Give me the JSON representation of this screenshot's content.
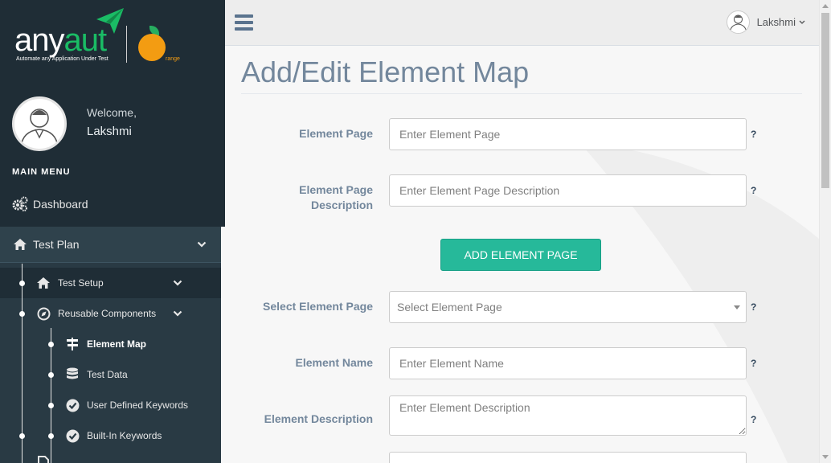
{
  "brand": {
    "logo_prefix": "any",
    "logo_accent": "aut",
    "tagline": "Automate any Application Under Test",
    "sub_brand": "range",
    "accent_color": "#1abc65",
    "orange_color": "#f39c12"
  },
  "sidebar": {
    "welcome_label": "Welcome,",
    "user_name": "Lakshmi",
    "menu_title": "MAIN MENU",
    "dashboard_label": "Dashboard",
    "test_plan_label": "Test Plan",
    "test_setup_label": "Test Setup",
    "reusable_components_label": "Reusable Components",
    "sub_items": [
      {
        "label": "Element Map",
        "icon": "signpost-icon",
        "active": true
      },
      {
        "label": "Test Data",
        "icon": "database-icon",
        "active": false
      },
      {
        "label": "User Defined Keywords",
        "icon": "check-circle-icon",
        "active": false
      },
      {
        "label": "Built-In Keywords",
        "icon": "check-circle-icon",
        "active": false
      }
    ]
  },
  "topbar": {
    "user_name": "Lakshmi"
  },
  "main": {
    "page_title": "Add/Edit Element Map",
    "element_page": {
      "label": "Element Page",
      "placeholder": "Enter Element Page",
      "value": "",
      "help": "?"
    },
    "element_page_description": {
      "label_line1": "Element Page",
      "label_line2": "Description",
      "placeholder": "Enter Element Page Description",
      "value": "",
      "help": "?"
    },
    "add_button_label": "ADD ELEMENT PAGE",
    "select_element_page": {
      "label": "Select Element Page",
      "selected": "Select Element Page",
      "help": "?"
    },
    "element_name": {
      "label": "Element Name",
      "placeholder": "Enter Element Name",
      "value": "",
      "help": "?"
    },
    "element_description": {
      "label": "Element Description",
      "placeholder": "Enter Element Description",
      "value": "",
      "help": "?"
    }
  },
  "colors": {
    "sidebar_dark": "#1f2d36",
    "sidebar_mid": "#293a44",
    "title_color": "#73879c",
    "button_green": "#26b99a"
  }
}
